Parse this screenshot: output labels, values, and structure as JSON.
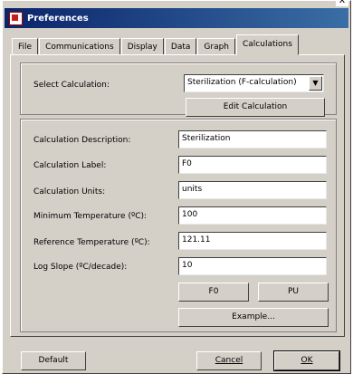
{
  "window": {
    "title": "Preferences",
    "close": "x"
  },
  "tabs": [
    {
      "label": "File"
    },
    {
      "label": "Communications"
    },
    {
      "label": "Display"
    },
    {
      "label": "Data"
    },
    {
      "label": "Graph"
    },
    {
      "label": "Calculations"
    }
  ],
  "select_calculation": {
    "label": "Select Calculation:",
    "value": "Sterilization (F-calculation)",
    "edit_button": "Edit Calculation"
  },
  "form": {
    "description_label": "Calculation Description:",
    "description_value": "Sterilization",
    "calc_label_label": "Calculation Label:",
    "calc_label_value": "F0",
    "units_label": "Calculation Units:",
    "units_value": "units",
    "min_temp_label": "Minimum Temperature (ºC):",
    "min_temp_value": "100",
    "ref_temp_label": "Reference Temperature (ºC):",
    "ref_temp_value": "121.11",
    "log_slope_label": "Log Slope (ºC/decade):",
    "log_slope_value": "10",
    "f0_button": "F0",
    "pu_button": "PU",
    "example_button": "Example..."
  },
  "footer": {
    "default_button": "Default",
    "cancel_button": "Cancel",
    "ok_button": "OK"
  }
}
